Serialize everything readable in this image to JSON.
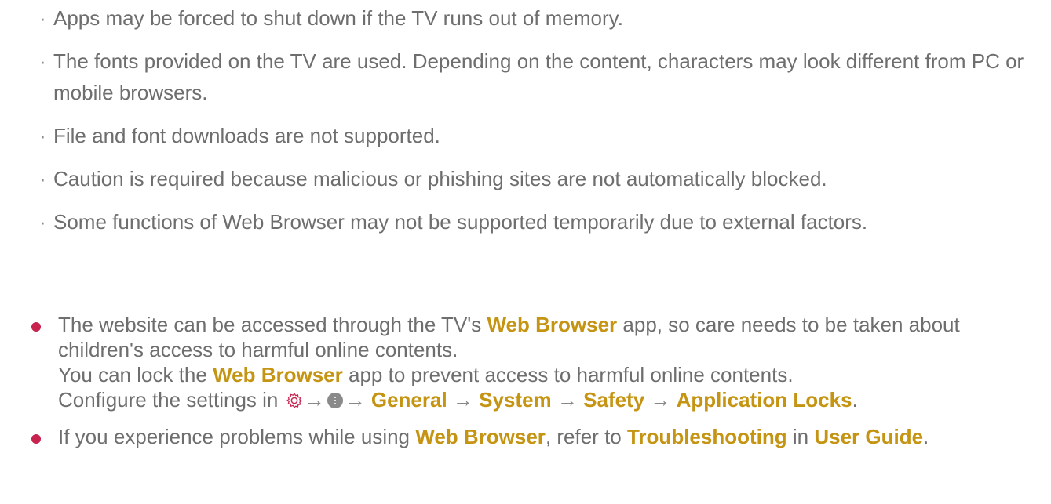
{
  "sub_items": [
    "Apps may be forced to shut down if the TV runs out of memory.",
    "The fonts provided on the TV are used. Depending on the content, characters may look different from PC or mobile browsers.",
    "File and font downloads are not supported.",
    "Caution is required because malicious or phishing sites are not automatically blocked.",
    "Some functions of Web Browser may not be supported temporarily due to external factors."
  ],
  "bullet1": {
    "l1_a": "The website can be accessed through the TV's ",
    "l1_hl": "Web Browser",
    "l1_b": " app, so care needs to be taken about children's access to harmful online contents.",
    "l2_a": "You can lock the ",
    "l2_hl": "Web Browser",
    "l2_b": " app to prevent access to harmful online contents.",
    "l3_a": "Configure the settings in ",
    "arrow": "→",
    "path": [
      "General",
      "System",
      "Safety",
      "Application Locks"
    ],
    "l3_end": "."
  },
  "bullet2": {
    "a": "If you experience problems while using ",
    "hl1": "Web Browser",
    "b": ", refer to ",
    "hl2": "Troubleshooting",
    "c": " in ",
    "hl3": "User Guide",
    "d": "."
  },
  "icons": {
    "settings": "gear-icon",
    "more": "more-icon"
  },
  "colors": {
    "highlight": "#c49412",
    "bullet": "#c8234f",
    "text": "#6e6e6e"
  }
}
